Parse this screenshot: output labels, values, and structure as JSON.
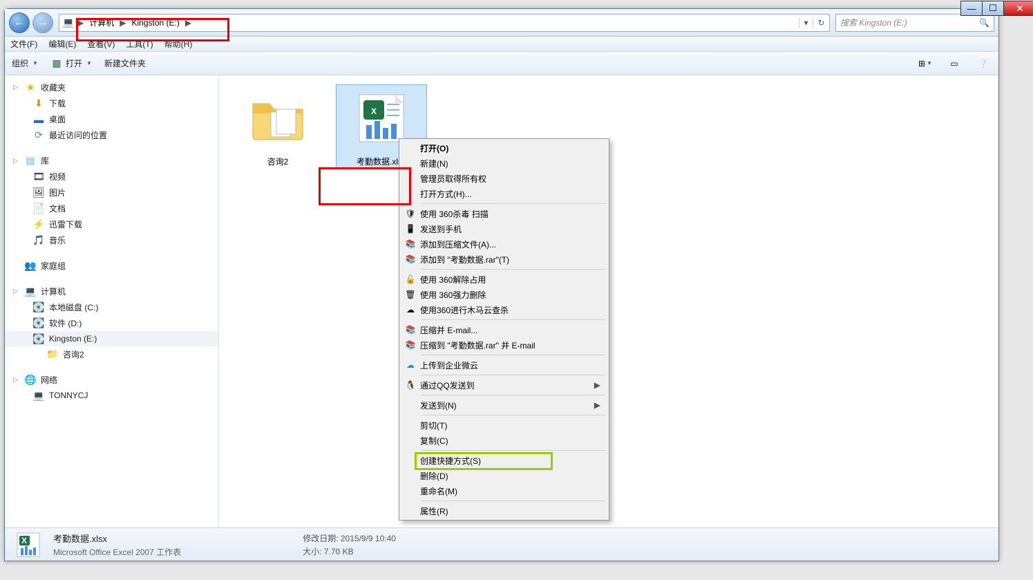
{
  "breadcrumb": {
    "root_icon": "computer-icon",
    "items": [
      "计算机",
      "Kingston (E:)"
    ],
    "sep": "▶"
  },
  "search": {
    "placeholder": "搜索 Kingston (E:)"
  },
  "menubar": [
    "文件(F)",
    "编辑(E)",
    "查看(V)",
    "工具(T)",
    "帮助(H)"
  ],
  "toolbar": {
    "organize": "组织",
    "open": "打开",
    "newfolder": "新建文件夹"
  },
  "tree": {
    "fav": {
      "head": "收藏夹",
      "items": [
        "下载",
        "桌面",
        "最近访问的位置"
      ]
    },
    "lib": {
      "head": "库",
      "items": [
        "视频",
        "图片",
        "文档",
        "迅雷下载",
        "音乐"
      ]
    },
    "home": {
      "head": "家庭组"
    },
    "comp": {
      "head": "计算机",
      "items": [
        "本地磁盘 (C:)",
        "软件 (D:)",
        "Kingston (E:)",
        "咨询2"
      ]
    },
    "net": {
      "head": "网络",
      "items": [
        "TONNYCJ"
      ]
    }
  },
  "files": {
    "folder": "咨询2",
    "excel": "考勤数据.xlsx"
  },
  "ctx": {
    "open": "打开(O)",
    "new": "新建(N)",
    "admin": "管理员取得所有权",
    "openwith": "打开方式(H)...",
    "scan360": "使用 360杀毒 扫描",
    "sendphone": "发送到手机",
    "addarc": "添加到压缩文件(A)...",
    "addrar": "添加到 \"考勤数据.rar\"(T)",
    "unlock360": "使用 360解除占用",
    "force360": "使用 360强力删除",
    "cloud360": "使用360进行木马云查杀",
    "zipemail": "压缩并 E-mail...",
    "ziprar": "压缩到 \"考勤数据.rar\" 并 E-mail",
    "qiye": "上传到企业微云",
    "qq": "通过QQ发送到",
    "sendto": "发送到(N)",
    "cut": "剪切(T)",
    "copy": "复制(C)",
    "shortcut": "创建快捷方式(S)",
    "delete": "删除(D)",
    "rename": "重命名(M)",
    "prop": "属性(R)"
  },
  "details": {
    "filename": "考勤数据.xlsx",
    "filetype": "Microsoft Office Excel 2007 工作表",
    "mod_label": "修改日期:",
    "mod_value": "2015/9/9 10:40",
    "size_label": "大小:",
    "size_value": "7.70 KB"
  }
}
